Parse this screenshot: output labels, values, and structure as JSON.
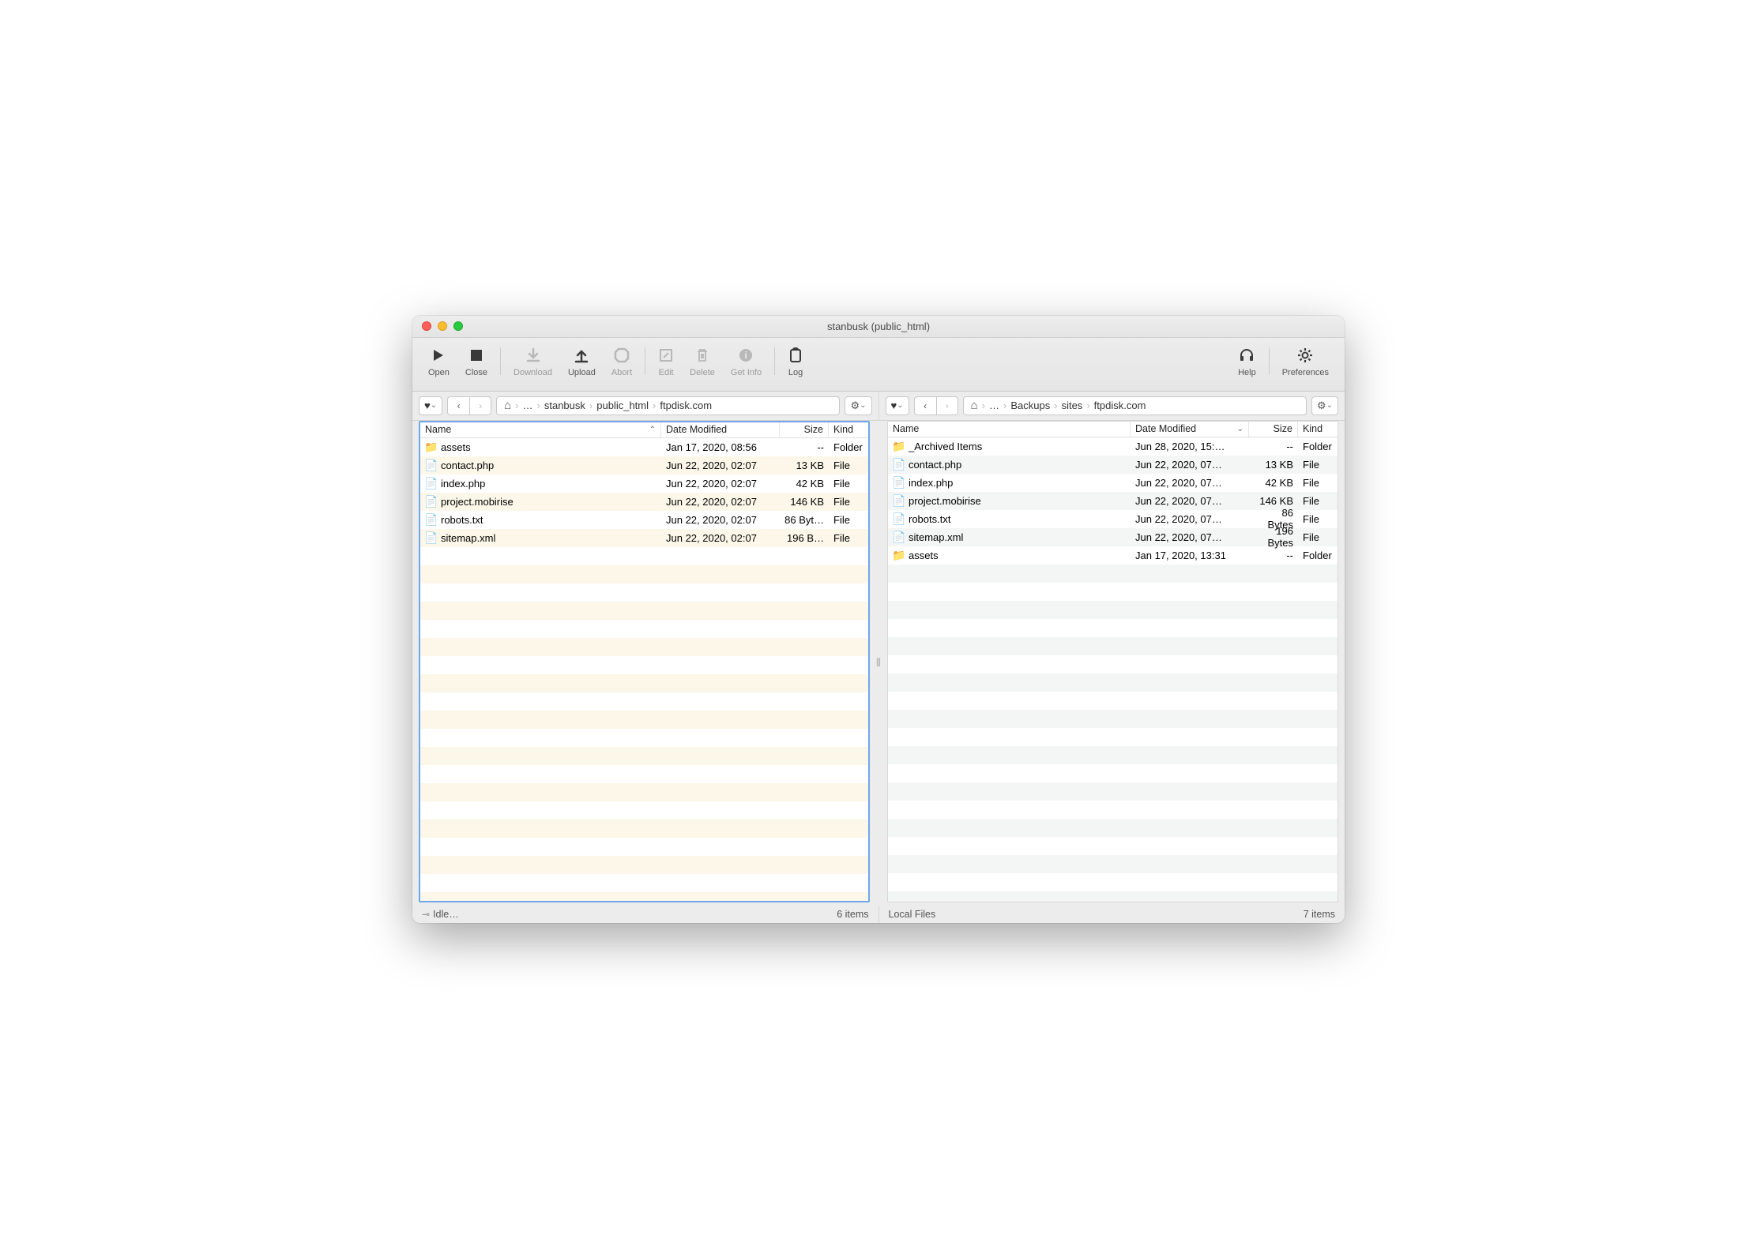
{
  "window": {
    "title": "stanbusk (public_html)"
  },
  "toolbar": {
    "open": "Open",
    "close": "Close",
    "download": "Download",
    "upload": "Upload",
    "abort": "Abort",
    "edit": "Edit",
    "delete": "Delete",
    "getinfo": "Get Info",
    "log": "Log",
    "help": "Help",
    "prefs": "Preferences"
  },
  "left": {
    "breadcrumbs": [
      "…",
      "stanbusk",
      "public_html",
      "ftpdisk.com"
    ],
    "columns": {
      "name": "Name",
      "date": "Date Modified",
      "size": "Size",
      "kind": "Kind"
    },
    "sort": {
      "column": "name",
      "dir": "asc"
    },
    "rows": [
      {
        "icon": "folder",
        "name": "assets",
        "date": "Jan 17, 2020, 08:56",
        "size": "--",
        "kind": "Folder"
      },
      {
        "icon": "php",
        "name": "contact.php",
        "date": "Jun 22, 2020, 02:07",
        "size": "13 KB",
        "kind": "File"
      },
      {
        "icon": "php",
        "name": "index.php",
        "date": "Jun 22, 2020, 02:07",
        "size": "42 KB",
        "kind": "File"
      },
      {
        "icon": "file",
        "name": "project.mobirise",
        "date": "Jun 22, 2020, 02:07",
        "size": "146 KB",
        "kind": "File"
      },
      {
        "icon": "txt",
        "name": "robots.txt",
        "date": "Jun 22, 2020, 02:07",
        "size": "86 Byt…",
        "kind": "File"
      },
      {
        "icon": "xml",
        "name": "sitemap.xml",
        "date": "Jun 22, 2020, 02:07",
        "size": "196 B…",
        "kind": "File"
      }
    ],
    "status_left": "Idle…",
    "status_right": "6 items"
  },
  "right": {
    "breadcrumbs": [
      "…",
      "Backups",
      "sites",
      "ftpdisk.com"
    ],
    "columns": {
      "name": "Name",
      "date": "Date Modified",
      "size": "Size",
      "kind": "Kind"
    },
    "sort": {
      "column": "date",
      "dir": "desc"
    },
    "rows": [
      {
        "icon": "folder",
        "name": "_Archived Items",
        "date": "Jun 28, 2020, 15:…",
        "size": "--",
        "kind": "Folder"
      },
      {
        "icon": "php",
        "name": "contact.php",
        "date": "Jun 22, 2020, 07…",
        "size": "13 KB",
        "kind": "File"
      },
      {
        "icon": "php",
        "name": "index.php",
        "date": "Jun 22, 2020, 07…",
        "size": "42 KB",
        "kind": "File"
      },
      {
        "icon": "file",
        "name": "project.mobirise",
        "date": "Jun 22, 2020, 07…",
        "size": "146 KB",
        "kind": "File"
      },
      {
        "icon": "txt",
        "name": "robots.txt",
        "date": "Jun 22, 2020, 07…",
        "size": "86 Bytes",
        "kind": "File"
      },
      {
        "icon": "xml",
        "name": "sitemap.xml",
        "date": "Jun 22, 2020, 07…",
        "size": "196 Bytes",
        "kind": "File"
      },
      {
        "icon": "folder",
        "name": "assets",
        "date": "Jan 17, 2020, 13:31",
        "size": "--",
        "kind": "Folder"
      }
    ],
    "status_left": "Local Files",
    "status_right": "7 items"
  }
}
